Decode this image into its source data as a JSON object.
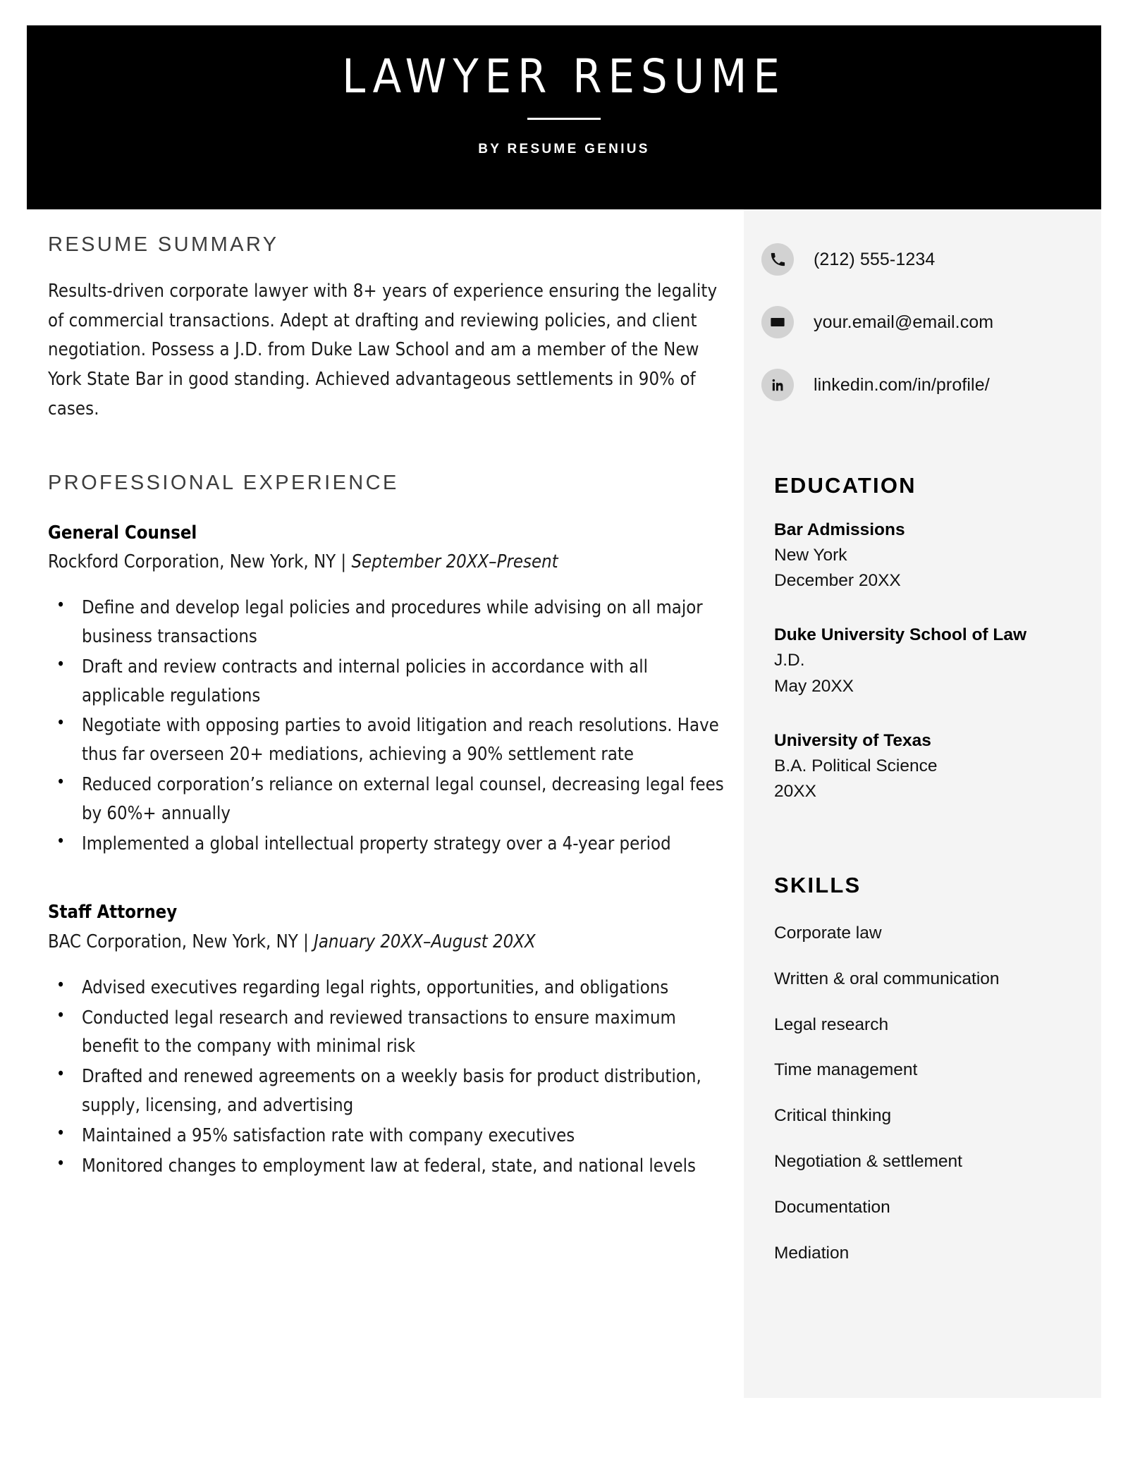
{
  "header": {
    "title": "LAWYER RESUME",
    "subtitle": "BY RESUME GENIUS",
    "background_color": "#000000",
    "text_color": "#ffffff"
  },
  "theme": {
    "sidebar_background": "#f4f4f4",
    "heading_color": "#3c3c3c",
    "body_text_color": "#1a1a1a",
    "icon_circle_color": "#d2d2d2"
  },
  "contact": {
    "items": [
      {
        "icon": "phone-icon",
        "value": "(212) 555-1234"
      },
      {
        "icon": "envelope-icon",
        "value": "your.email@email.com"
      },
      {
        "icon": "linkedin-icon",
        "value": "linkedin.com/in/profile/"
      }
    ]
  },
  "summary": {
    "heading": "RESUME SUMMARY",
    "text": "Results-driven corporate lawyer with 8+ years of experience ensuring the legality of commercial transactions. Adept at drafting and reviewing policies, and client negotiation. Possess a J.D. from Duke Law School and am a member of the New York State Bar in good standing. Achieved advantageous settlements in 90% of cases."
  },
  "experience": {
    "heading": "PROFESSIONAL EXPERIENCE",
    "jobs": [
      {
        "title": "General Counsel",
        "employer": "Rockford Corporation, New York, NY | ",
        "dates": "September 20XX–Present",
        "bullets": [
          "Define and develop legal policies and procedures while advising on all major business transactions",
          "Draft and review contracts and internal policies in accordance with all applicable regulations",
          "Negotiate with opposing parties to avoid litigation and reach resolutions. Have thus far overseen 20+ mediations, achieving a 90% settlement rate",
          "Reduced corporation’s reliance on external legal counsel, decreasing legal fees by 60%+ annually",
          "Implemented a global intellectual property strategy over a 4-year period"
        ]
      },
      {
        "title": "Staff Attorney",
        "employer": "BAC Corporation, New York, NY | ",
        "dates": "January 20XX–August 20XX",
        "bullets": [
          "Advised executives regarding legal rights, opportunities, and obligations",
          "Conducted legal research and reviewed transactions to ensure maximum benefit to the company with minimal risk",
          "Drafted and renewed agreements on a weekly basis for product distribution, supply, licensing, and advertising",
          "Maintained a 95% satisfaction rate with company executives",
          "Monitored changes to employment law at federal, state, and national levels"
        ]
      }
    ]
  },
  "education": {
    "heading": "EDUCATION",
    "entries": [
      {
        "school": "Bar Admissions",
        "line1": "New York",
        "line2": "December 20XX"
      },
      {
        "school": "Duke University School of Law",
        "line1": "J.D.",
        "line2": "May 20XX"
      },
      {
        "school": "University of Texas",
        "line1": "B.A. Political Science",
        "line2": "20XX"
      }
    ]
  },
  "skills": {
    "heading": "SKILLS",
    "items": [
      "Corporate law",
      "Written & oral communication",
      "Legal research",
      "Time management",
      "Critical thinking",
      "Negotiation & settlement",
      "Documentation",
      "Mediation"
    ]
  }
}
